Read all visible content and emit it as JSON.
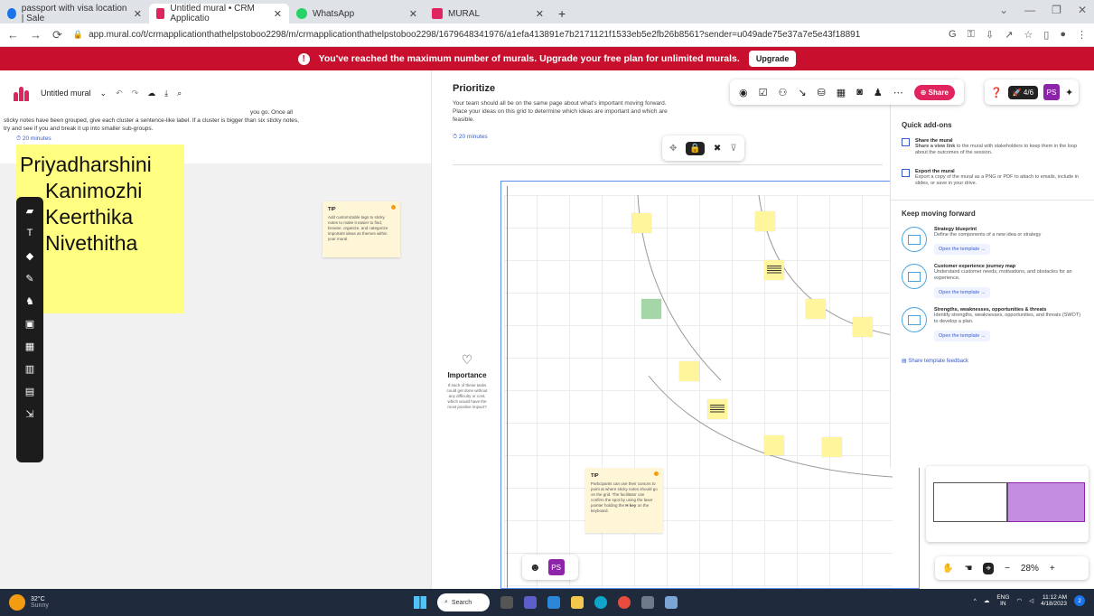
{
  "browser": {
    "tabs": [
      {
        "title": "passport with visa location | Sale",
        "active": false
      },
      {
        "title": "Untitled mural • CRM Applicatio",
        "active": true
      },
      {
        "title": "WhatsApp",
        "active": false
      },
      {
        "title": "MURAL",
        "active": false
      }
    ],
    "url": "app.mural.co/t/crmapplicationthathelpstoboo2298/m/crmapplicationthathelpstoboo2298/1679648341976/a1efa413891e7b2171121f1533eb5e2fb26b8561?sender=u049ade75e37a7e5e43f18891"
  },
  "banner": {
    "message": "You've reached the maximum number of murals. Upgrade your free plan for unlimited murals.",
    "upgrade_label": "Upgrade"
  },
  "mural": {
    "title": "Untitled mural",
    "left_section": {
      "description": "sticky notes have been grouped, give each cluster a sentence-like label. If a cluster is bigger than six sticky notes, try and see if you and break it up into smaller sub-groups.",
      "desc_fragment": "you go. Once all",
      "minutes": "20 minutes",
      "names": [
        "Priyadharshini",
        "Kanimozhi",
        "Keerthika",
        "Nivethitha"
      ]
    },
    "tip1": {
      "title": "TIP",
      "body": "Add customizable tags to sticky notes to make it easier to find, browse, organize, and categorize important ideas as themes within your mural."
    },
    "prioritize": {
      "title": "Prioritize",
      "description": "Your team should all be on the same page about what's important moving forward. Place your ideas on this grid to determine which ideas are important and which are feasible.",
      "minutes": "20 minutes"
    },
    "importance": {
      "label": "Importance",
      "description": "If each of these tasks could get done without any difficulty or cost, which would have the most positive impact?"
    },
    "tip2": {
      "title": "TIP",
      "body": "Participants can use their cursors to point at where sticky notes should go on the grid. The facilitator can confirm the spot by using the laser pointer holding the",
      "key": "H key",
      "tail": "on the keyboard."
    }
  },
  "toolbar": {
    "share_label": "Share",
    "count_label": "4/6",
    "avatar_initials": "PS"
  },
  "panel": {
    "quick_addons_title": "Quick add-ons",
    "quick_addons": [
      {
        "title": "Share the mural",
        "link": "Share a view link",
        "body": "to the mural with stakeholders to keep them in the loop about the outcomes of the session."
      },
      {
        "title": "Export the mural",
        "body": "Export a copy of the mural as a PNG or PDF to attach to emails, include in slides, or save in your drive."
      }
    ],
    "keep_moving_title": "Keep moving forward",
    "templates": [
      {
        "title": "Strategy blueprint",
        "body": "Define the components of a new idea or strategy",
        "open": "Open the template →"
      },
      {
        "title": "Customer experience journey map",
        "body": "Understand customer needs, motivations, and obstacles for an experience.",
        "open": "Open the template →"
      },
      {
        "title": "Strengths, weaknesses, opportunities & threats",
        "body": "Identify strengths, weaknesses, opportunities, and threats (SWOT) to develop a plan.",
        "open": "Open the template →"
      }
    ],
    "feedback_label": "Share template feedback"
  },
  "zoom": {
    "level": "28%"
  },
  "taskbar": {
    "weather_temp": "32°C",
    "weather_desc": "Sunny",
    "search_label": "Search",
    "lang": "ENG",
    "region": "IN",
    "time": "11:12 AM",
    "date": "4/18/2023",
    "notif_count": "2"
  }
}
